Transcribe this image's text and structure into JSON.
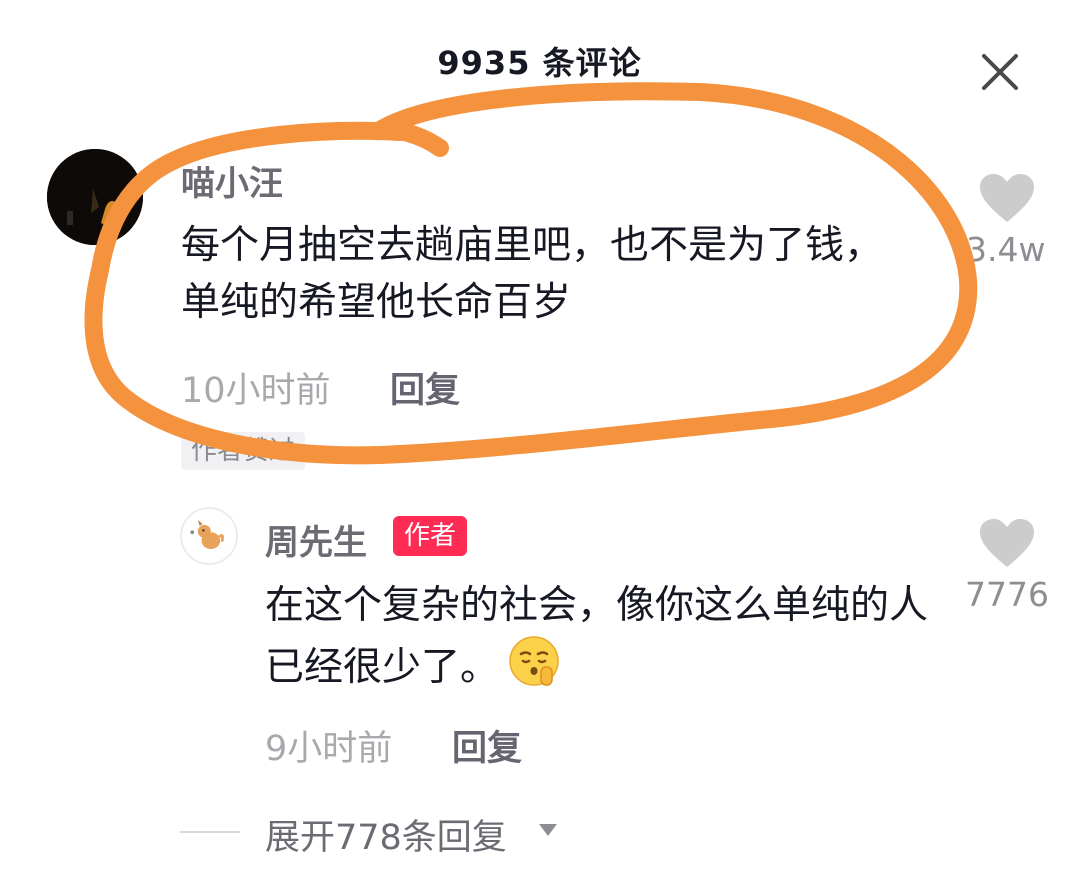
{
  "header": {
    "title": "9935 条评论",
    "close_icon": "close-icon"
  },
  "comments": [
    {
      "username": "喵小汪",
      "content": "每个月抽空去趟庙里吧，也不是为了钱，单纯的希望他长命百岁",
      "time": "10小时前",
      "reply_label": "回复",
      "tag": "作者赞过",
      "like_count": "3.4w",
      "icons": [
        "avatar",
        "heart-icon"
      ]
    },
    {
      "username": "周先生",
      "badge": "作者",
      "content": "在这个复杂的社会，像你这么单纯的人已经很少了。",
      "time": "9小时前",
      "reply_label": "回复",
      "like_count": "7776",
      "icons": [
        "avatar",
        "heart-icon",
        "shush-emoji-icon"
      ]
    }
  ],
  "expand": {
    "label": "展开778条回复",
    "icon": "chevron-down-icon"
  },
  "colors": {
    "author_badge": "#fe2c55",
    "annotation_circle": "#f5923e",
    "like_icon": "#cccccc",
    "meta_text": "#a8a9ad"
  }
}
